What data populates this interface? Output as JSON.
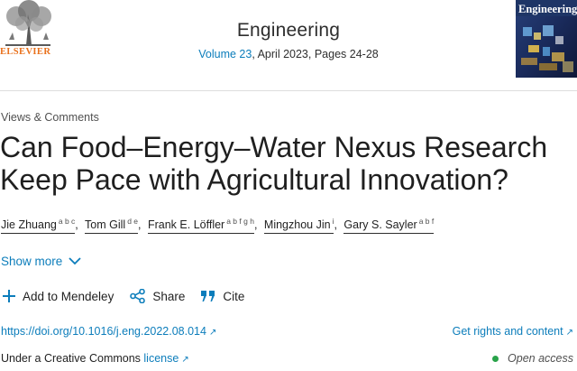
{
  "journal": {
    "publisher": "ELSEVIER",
    "name": "Engineering",
    "volume_link": "Volume 23",
    "issue_info": ", April 2023, Pages 24-28",
    "cover_title": "Engineering"
  },
  "article": {
    "category": "Views & Comments",
    "title": "Can Food–Energy–Water Nexus Research Keep Pace with Agricultural Innovation?"
  },
  "authors": [
    {
      "name": "Jie Zhuang",
      "affil": "a b c"
    },
    {
      "name": "Tom Gill",
      "affil": "d e"
    },
    {
      "name": "Frank E. Löffler",
      "affil": "a b f g h"
    },
    {
      "name": "Mingzhou Jin",
      "affil": "i"
    },
    {
      "name": "Gary S. Sayler",
      "affil": "a b f"
    }
  ],
  "show_more": "Show more",
  "actions": {
    "mendeley": "Add to Mendeley",
    "share": "Share",
    "cite": "Cite"
  },
  "links": {
    "doi": "https://doi.org/10.1016/j.eng.2022.08.014",
    "rights": "Get rights and content",
    "license_prefix": "Under a Creative Commons ",
    "license_link": "license",
    "open_access": "Open access"
  },
  "colors": {
    "link": "#0c7dbb",
    "elsevier_orange": "#e9711c",
    "open_access_green": "#29a34a"
  },
  "icons": [
    "elsevier-tree-logo",
    "chevron-down-icon",
    "plus-icon",
    "share-icon",
    "quote-icon",
    "external-arrow-icon"
  ]
}
